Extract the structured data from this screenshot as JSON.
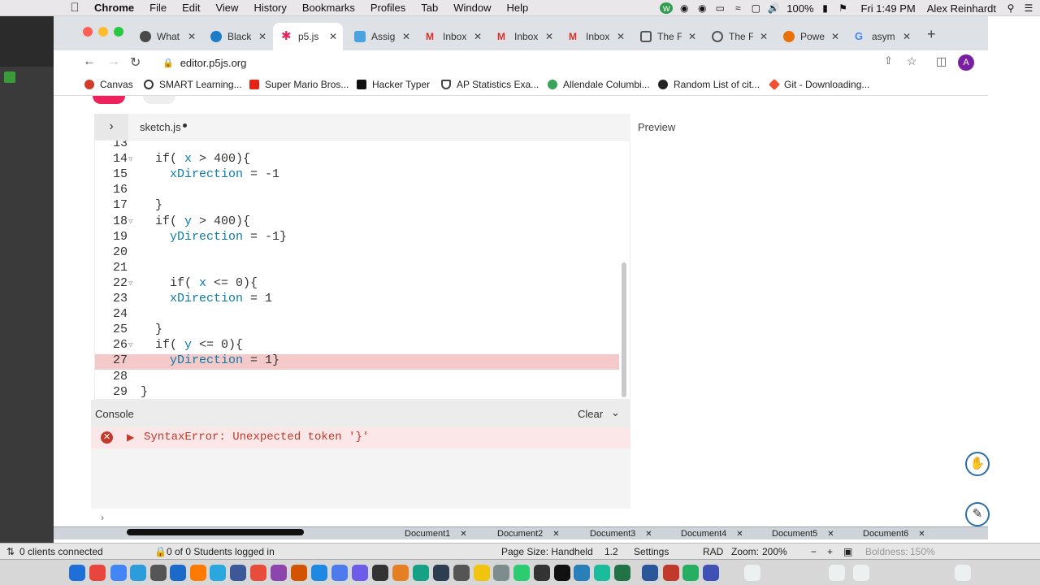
{
  "menubar": {
    "app": "Chrome",
    "items": [
      "File",
      "Edit",
      "View",
      "History",
      "Bookmarks",
      "Profiles",
      "Tab",
      "Window",
      "Help"
    ],
    "battery": "100%",
    "time": "Fri 1:49 PM",
    "user": "Alex Reinhardt"
  },
  "tabs": [
    {
      "title": "What",
      "color": "#4a4a4a"
    },
    {
      "title": "Black",
      "color": "#1e7dc9"
    },
    {
      "title": "p5.js",
      "color": "#ed225d",
      "active": true
    },
    {
      "title": "Assig",
      "color": "#4aa3df"
    },
    {
      "title": "Inbox",
      "color": "#d93025"
    },
    {
      "title": "Inbox",
      "color": "#d93025"
    },
    {
      "title": "Inbox",
      "color": "#d93025"
    },
    {
      "title": "The F",
      "color": "#555555"
    },
    {
      "title": "The F",
      "color": "#555555"
    },
    {
      "title": "Powe",
      "color": "#e8710a"
    },
    {
      "title": "asym",
      "color": "#4285f4"
    }
  ],
  "url": "editor.p5js.org",
  "profile_initial": "A",
  "bookmarks": [
    {
      "label": "Canvas",
      "color": "#d13b2a"
    },
    {
      "label": "SMART Learning...",
      "color": "#333333"
    },
    {
      "label": "Super Mario Bros...",
      "color": "#e62117"
    },
    {
      "label": "Hacker Typer",
      "color": "#111111"
    },
    {
      "label": "AP Statistics Exa...",
      "color": "#444444"
    },
    {
      "label": "Allendale Columbi...",
      "color": "#3aa35b"
    },
    {
      "label": "Random List of cit...",
      "color": "#222222"
    },
    {
      "label": "Git - Downloading...",
      "color": "#f05133"
    }
  ],
  "editor": {
    "filename": "sketch.js",
    "preview_label": "Preview",
    "lines": [
      {
        "n": "13",
        "code": ""
      },
      {
        "n": "14",
        "code": "  if( x > 400){"
      },
      {
        "n": "15",
        "code": "    xDirection = -1"
      },
      {
        "n": "16",
        "code": ""
      },
      {
        "n": "17",
        "code": "  }"
      },
      {
        "n": "18",
        "code": "  if( y > 400){"
      },
      {
        "n": "19",
        "code": "    yDirection = -1}"
      },
      {
        "n": "20",
        "code": ""
      },
      {
        "n": "21",
        "code": ""
      },
      {
        "n": "22",
        "code": "    if( x <= 0){"
      },
      {
        "n": "23",
        "code": "    xDirection = 1"
      },
      {
        "n": "24",
        "code": ""
      },
      {
        "n": "25",
        "code": "  }"
      },
      {
        "n": "26",
        "code": "  if( y <= 0){"
      },
      {
        "n": "27",
        "code": "    yDirection = 1}"
      },
      {
        "n": "28",
        "code": ""
      },
      {
        "n": "29",
        "code": "}"
      }
    ]
  },
  "console": {
    "title": "Console",
    "clear": "Clear",
    "error": "SyntaxError: Unexpected token '}'",
    "prompt": "›"
  },
  "doc_tabs": [
    "Document1",
    "Document2",
    "Document3",
    "Document4",
    "Document5",
    "Document6"
  ],
  "status": {
    "clients": "0 clients connected",
    "students": "0 of 0 Students logged in",
    "page_size": "Page Size: Handheld",
    "version": "1.2",
    "settings": "Settings",
    "rad": "RAD",
    "zoom_label": "Zoom:",
    "zoom": "200%",
    "boldness_label": "Boldness:",
    "boldness": "150%"
  }
}
